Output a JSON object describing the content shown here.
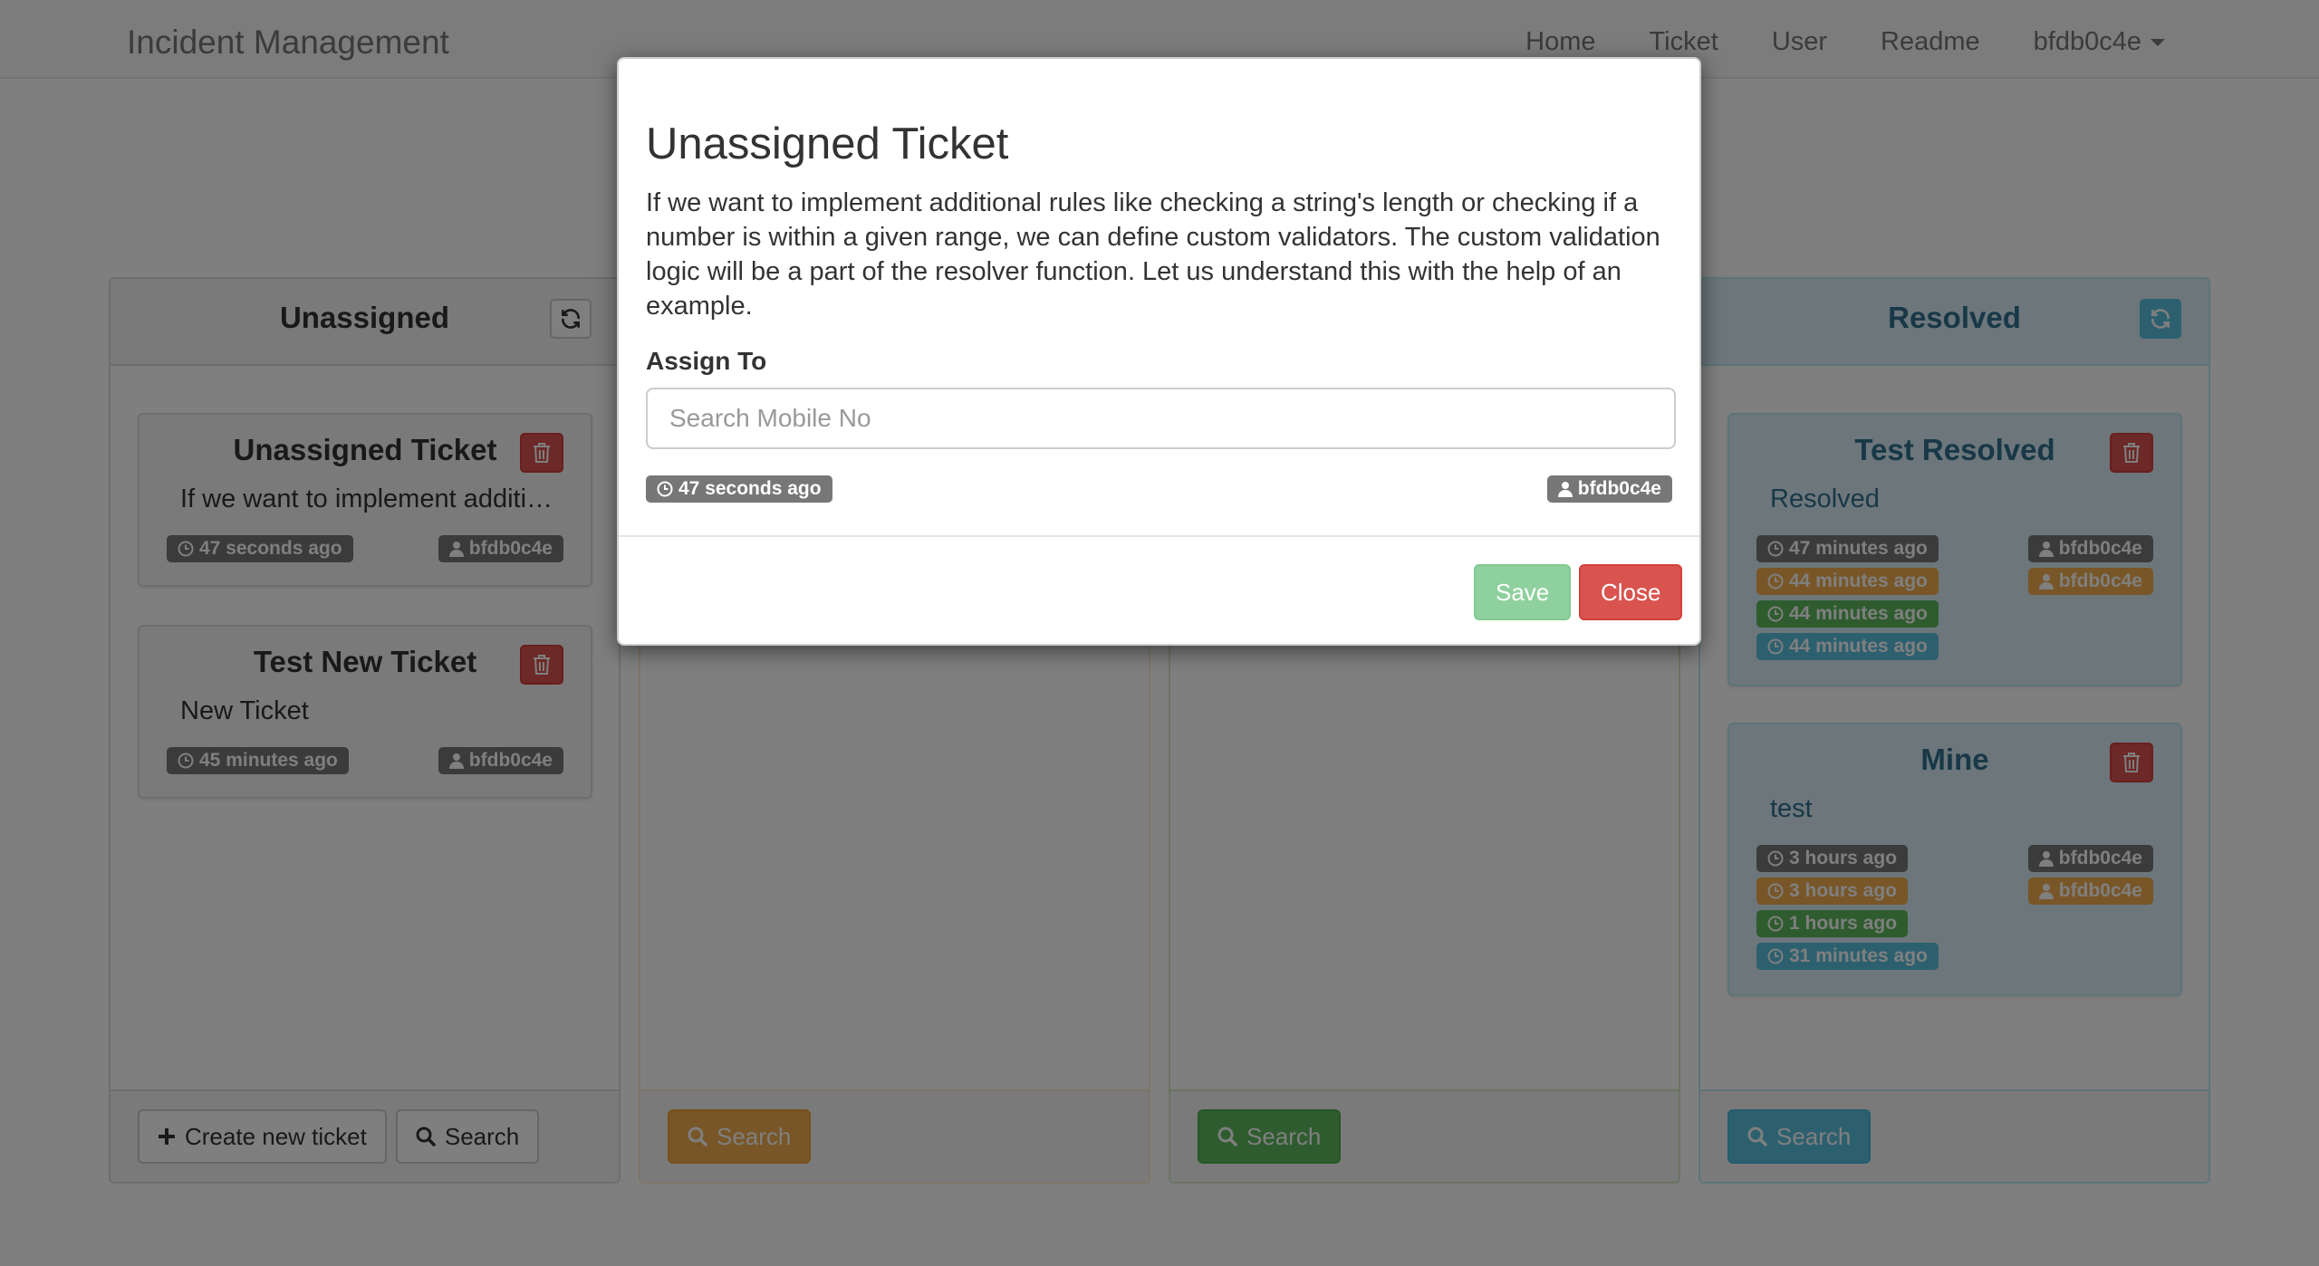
{
  "navbar": {
    "brand": "Incident Management",
    "links": [
      "Home",
      "Ticket",
      "User",
      "Readme"
    ],
    "user": "bfdb0c4e"
  },
  "columns": {
    "unassigned": {
      "title": "Unassigned",
      "create_label": "Create new ticket",
      "search_label": "Search",
      "cards": [
        {
          "title": "Unassigned Ticket",
          "description": "If we want to implement additional rules like checking a string's length or checking if a number is within a given range, we can define custom validators.",
          "time": "47 seconds ago",
          "user": "bfdb0c4e"
        },
        {
          "title": "Test New Ticket",
          "description": "New Ticket",
          "time": "45 minutes ago",
          "user": "bfdb0c4e"
        }
      ]
    },
    "assigned": {
      "search_label": "Search"
    },
    "in_progress": {
      "search_label": "Search"
    },
    "resolved": {
      "title": "Resolved",
      "search_label": "Search",
      "cards": [
        {
          "title": "Test Resolved",
          "description": "Resolved",
          "times": [
            "47 minutes ago",
            "44 minutes ago",
            "44 minutes ago",
            "44 minutes ago"
          ],
          "users": [
            "bfdb0c4e",
            "bfdb0c4e"
          ]
        },
        {
          "title": "Mine",
          "description": "test",
          "times": [
            "3 hours ago",
            "3 hours ago",
            "1 hours ago",
            "31 minutes ago"
          ],
          "users": [
            "bfdb0c4e",
            "bfdb0c4e"
          ]
        }
      ]
    }
  },
  "modal": {
    "title": "Unassigned Ticket",
    "description": "If we want to implement additional rules like checking a string's length or checking if a number is within a given range, we can define custom validators. The custom validation logic will be a part of the resolver function. Let us understand this with the help of an example.",
    "assign_label": "Assign To",
    "search_placeholder": "Search Mobile No",
    "time": "47 seconds ago",
    "user": "bfdb0c4e",
    "save_label": "Save",
    "close_label": "Close"
  },
  "colors": {
    "danger": "#d9534f",
    "warning": "#f0ad4e",
    "success": "#5cb85c",
    "info": "#5bc0de",
    "label_default": "#777777"
  }
}
